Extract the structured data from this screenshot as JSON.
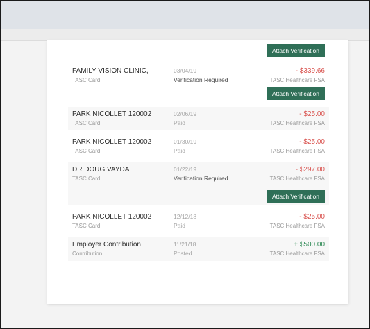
{
  "colors": {
    "accent": "#2f6f57",
    "negative": "#d9534f",
    "positive": "#2f8a55"
  },
  "attach_label": "Attach Verification",
  "transactions": [
    {
      "merchant": "FAMILY VISION CLINIC,",
      "source": "TASC Card",
      "date": "03/04/19",
      "status": "Verification Required",
      "amount": "- $339.66",
      "account": "TASC Healthcare FSA"
    },
    {
      "merchant": "PARK NICOLLET 120002",
      "source": "TASC Card",
      "date": "02/06/19",
      "status": "Paid",
      "amount": "- $25.00",
      "account": "TASC Healthcare FSA"
    },
    {
      "merchant": "PARK NICOLLET 120002",
      "source": "TASC Card",
      "date": "01/30/19",
      "status": "Paid",
      "amount": "- $25.00",
      "account": "TASC Healthcare FSA"
    },
    {
      "merchant": "DR DOUG VAYDA",
      "source": "TASC Card",
      "date": "01/22/19",
      "status": "Verification Required",
      "amount": "- $297.00",
      "account": "TASC Healthcare FSA"
    },
    {
      "merchant": "PARK NICOLLET 120002",
      "source": "TASC Card",
      "date": "12/12/18",
      "status": "Paid",
      "amount": "- $25.00",
      "account": "TASC Healthcare FSA"
    },
    {
      "merchant": "Employer Contribution",
      "source": "Contribution",
      "date": "11/21/18",
      "status": "Posted",
      "amount": "+ $500.00",
      "account": "TASC Healthcare FSA"
    }
  ]
}
